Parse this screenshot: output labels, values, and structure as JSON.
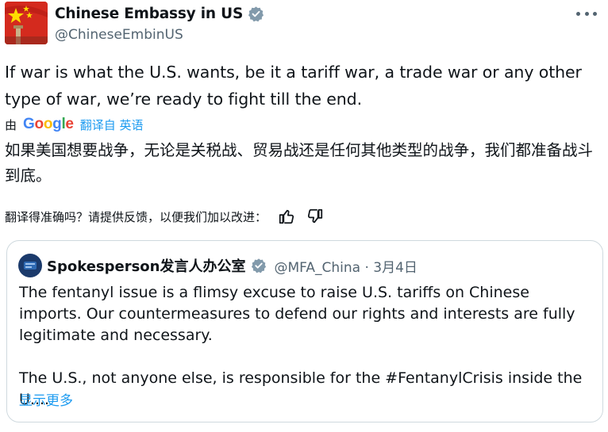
{
  "account": {
    "display_name": "Chinese Embassy in US",
    "handle": "@ChineseEmbinUS",
    "avatar_icon": "china-flag-avatar"
  },
  "tweet": {
    "text": "If war is what the U.S. wants, be it a tariff war, a trade war or any other type of war, we’re ready to fight till the end."
  },
  "translation": {
    "by_label": "由",
    "google_letters": [
      "G",
      "o",
      "o",
      "g",
      "l",
      "e"
    ],
    "translated_from": "翻译自 英语",
    "translated_text": "如果美国想要战争，无论是关税战、贸易战还是任何其他类型的战争，我们都准备战斗到底。",
    "feedback_prompt": "翻译得准确吗？请提供反馈，以便我们加以改进："
  },
  "quoted_tweet": {
    "display_name": "Spokesperson发言人办公室",
    "handle_and_date": "@MFA_China · 3月4日",
    "paragraph_1": "The fentanyl issue is a flimsy excuse to raise U.S. tariffs on Chinese imports. Our countermeasures to defend our rights and interests are fully legitimate and necessary.",
    "paragraph_2": "The U.S., not anyone else, is responsible for the #FentanylCrisis inside the U....",
    "show_more": "显示更多"
  },
  "colors": {
    "link_blue": "#1d9bf0",
    "verified_gray": "#829aab",
    "secondary_text": "#536471",
    "flag_red": "#d42a1e",
    "flag_yellow": "#ffde00"
  }
}
